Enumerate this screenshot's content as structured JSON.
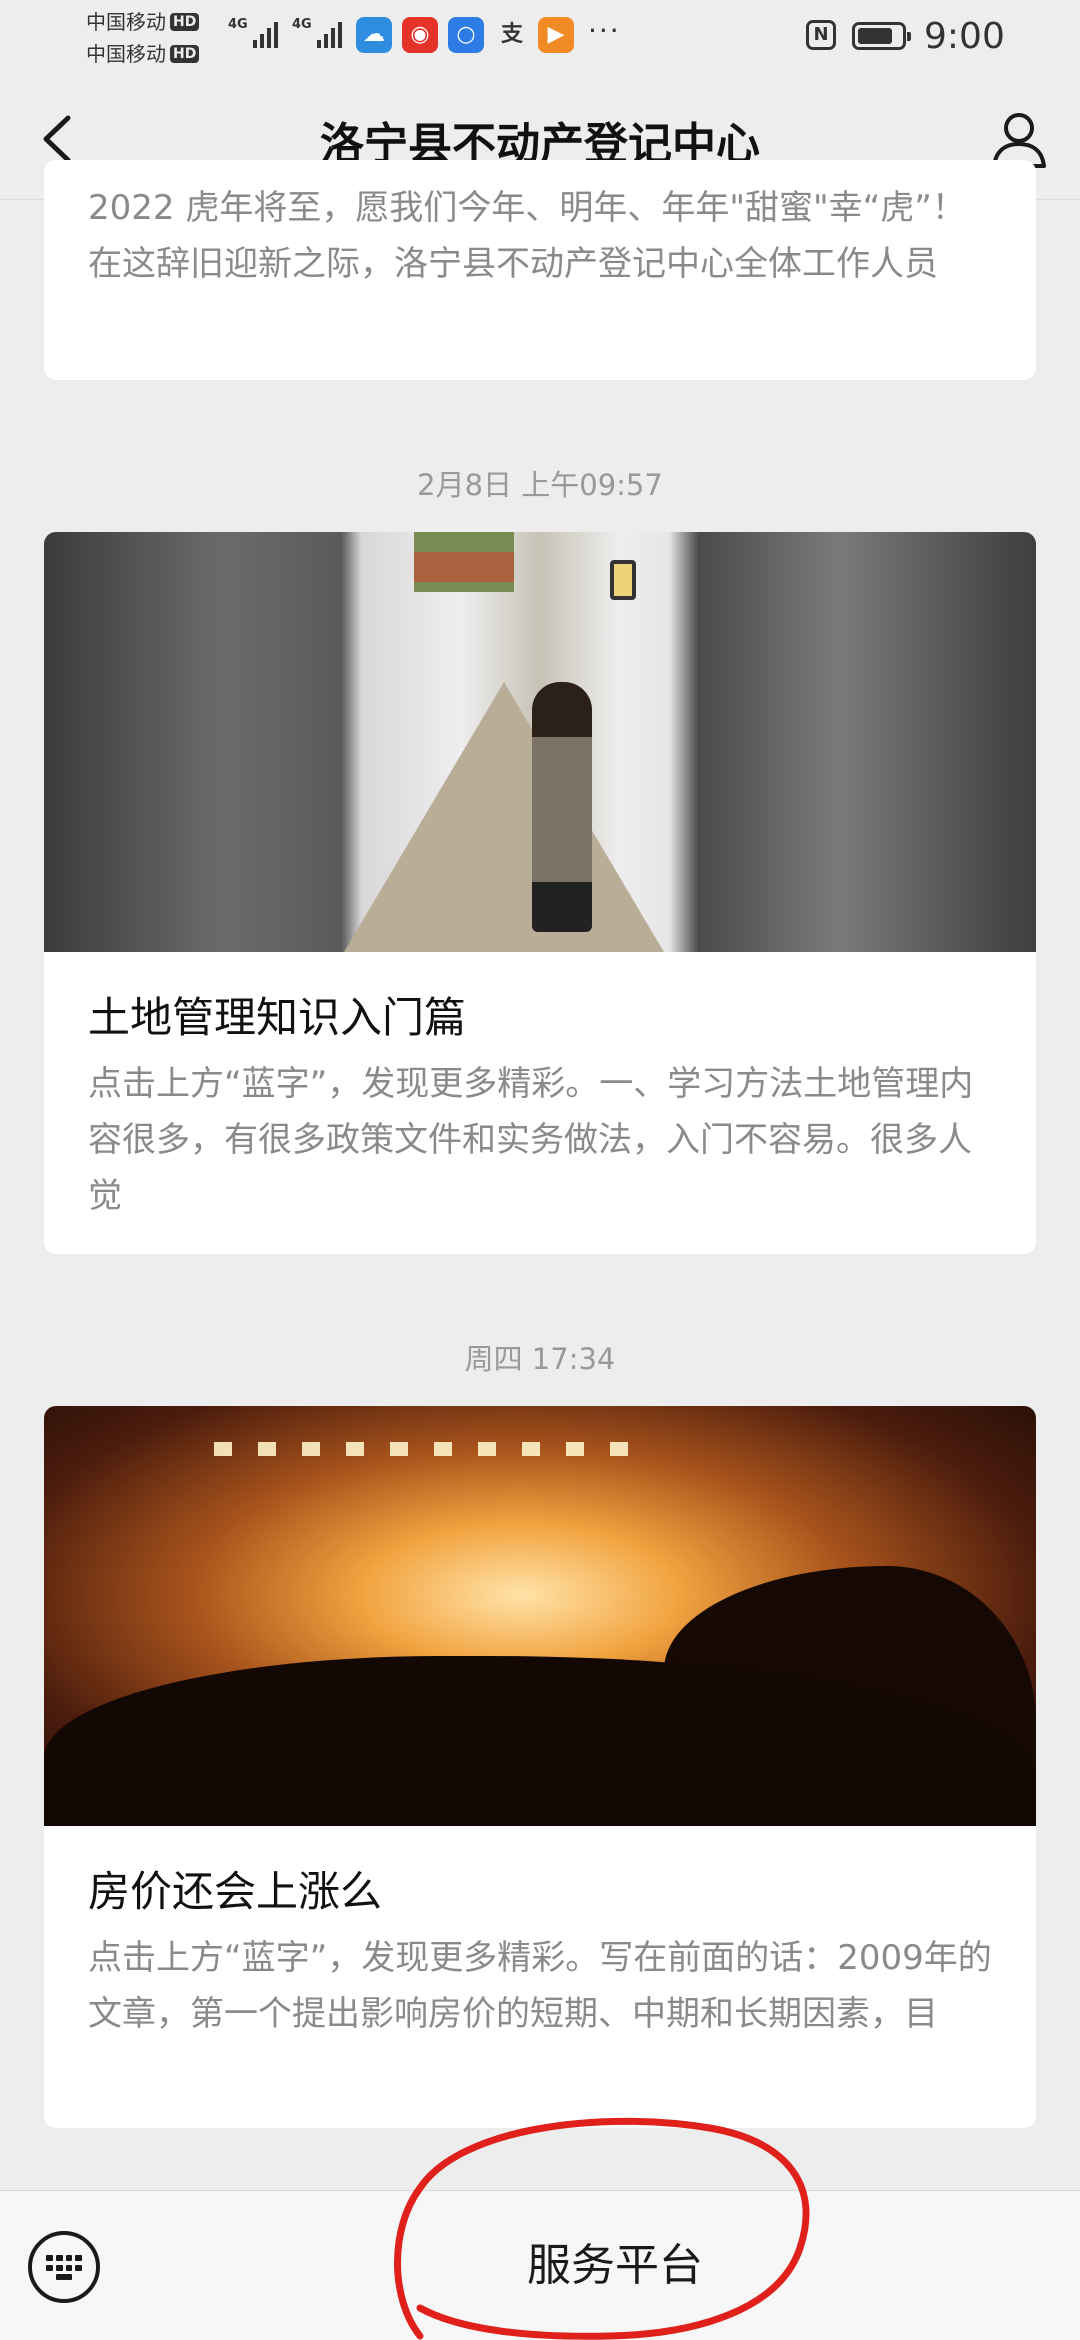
{
  "status_bar": {
    "carrier_1": "中国移动",
    "carrier_2": "中国移动",
    "hd_badge": "HD",
    "network": "4G",
    "overflow": "···",
    "nfc": "N",
    "time": "9:00",
    "app_icons": [
      "weather-icon",
      "weibo-icon",
      "lightbulb-icon",
      "alipay-icon",
      "video-icon"
    ],
    "battery_level": 0.8
  },
  "header": {
    "title": "洛宁县不动产登记中心"
  },
  "feed": [
    {
      "digest": "2022 虎年将至，愿我们今年、明年、年年\"甜蜜\"幸“虎”！在这辞旧迎新之际，洛宁县不动产登记中心全体工作人员"
    },
    {
      "timestamp": "2月8日 上午09:57",
      "title": "土地管理知识入门篇",
      "digest": "点击上方“蓝字”，发现更多精彩。一、学习方法土地管理内容很多，有很多政策文件和实务做法，入门不容易。很多人觉"
    },
    {
      "timestamp": "周四 17:34",
      "title": "房价还会上涨么",
      "digest": "点击上方“蓝字”，发现更多精彩。写在前面的话：2009年的文章，第一个提出影响房价的短期、中期和长期因素，目"
    }
  ],
  "bottom_bar": {
    "menu_label": "服务平台"
  },
  "colors": {
    "background": "#ededed",
    "card": "#ffffff",
    "annotation": "#e0201a"
  }
}
